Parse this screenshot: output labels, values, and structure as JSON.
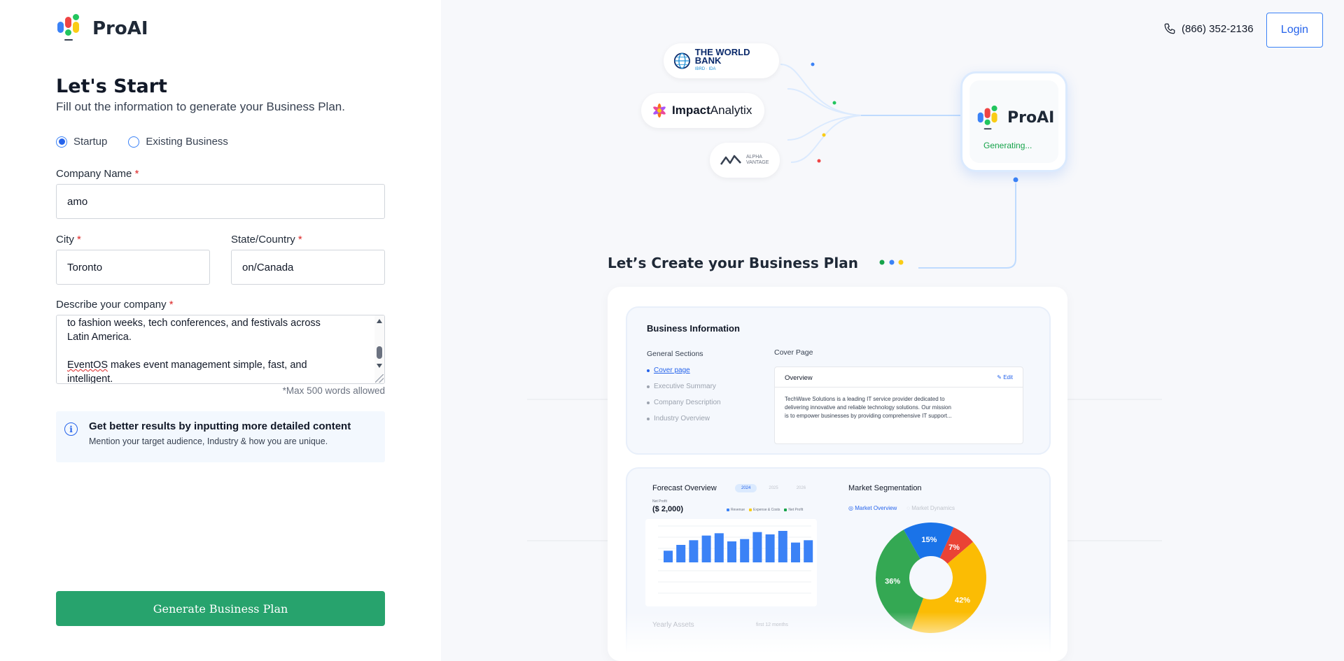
{
  "brand": {
    "name": "ProAI"
  },
  "form": {
    "title": "Let's Start",
    "subtitle": "Fill out the information to generate your Business Plan.",
    "business_type": {
      "options": [
        {
          "label": "Startup",
          "selected": true
        },
        {
          "label": "Existing Business",
          "selected": false
        }
      ]
    },
    "company_name": {
      "label": "Company Name",
      "value": "amo"
    },
    "city": {
      "label": "City",
      "value": "Toronto"
    },
    "state": {
      "label": "State/Country",
      "value": "on/Canada"
    },
    "describe": {
      "label": "Describe your company",
      "line1": "to fashion weeks, tech conferences, and festivals across",
      "line2": "Latin America.",
      "spell_word": "EventOS",
      "line3_rest": " makes event management simple, fast, and",
      "line4": "intelligent."
    },
    "required_mark": "*",
    "max_words_hint": "*Max 500 words allowed",
    "tip": {
      "title": "Get better results by inputting more detailed content",
      "text": "Mention your target audience, Industry & how you are unique."
    },
    "submit_label": "Generate Business Plan"
  },
  "header": {
    "phone": "(866) 352-2136",
    "login_label": "Login"
  },
  "integrations": {
    "world_bank": {
      "name": "THE WORLD BANK",
      "sub": "IBRD · IDA"
    },
    "impact": {
      "bold": "Impact",
      "rest": "Analytix"
    },
    "alpha": {
      "line1": "ALPHA",
      "line2": "VANTAGE"
    }
  },
  "generator": {
    "name": "ProAI",
    "status": "Generating..."
  },
  "preview": {
    "heading": "Let’s Create your Business Plan",
    "business_info": {
      "title": "Business Information",
      "general_sections_label": "General Sections",
      "sections": [
        "Cover page",
        "Executive Summary",
        "Company Description",
        "Industry Overview"
      ],
      "active_section": 0,
      "cover_page_label": "Cover Page",
      "overview_label": "Overview",
      "edit_label": "Edit",
      "overview_text": "TechWave Solutions is a leading IT service provider dedicated to delivering innovative and reliable technology solutions. Our mission is to empower businesses by providing comprehensive IT support..."
    },
    "forecast": {
      "title": "Forecast Overview",
      "years": [
        "2024",
        "2025",
        "2026"
      ],
      "selected_year": "2024",
      "net_profit_label": "Net Profit",
      "net_profit_value": "($ 2,000)",
      "legend": [
        {
          "name": "Revenue",
          "color": "#3b82f6"
        },
        {
          "name": "Expense & Costs",
          "color": "#facc15"
        },
        {
          "name": "Net Profit",
          "color": "#16a34a"
        }
      ]
    },
    "segmentation": {
      "title": "Market Segmentation",
      "tabs": [
        "Market Overview",
        "Market Dynamics"
      ]
    },
    "yearly_assets": {
      "title": "Yearly Assets",
      "period": "first 12 months"
    }
  },
  "chart_data": [
    {
      "type": "bar",
      "title": "Forecast Overview",
      "categories": [
        "1",
        "2",
        "3",
        "4",
        "5",
        "6",
        "7",
        "8",
        "9",
        "10",
        "11",
        "12"
      ],
      "values": [
        10,
        15,
        19,
        23,
        25,
        18,
        20,
        26,
        24,
        27,
        17,
        19
      ],
      "color": "#3b82f6"
    },
    {
      "type": "pie",
      "title": "Market Segmentation",
      "labels": [
        "15%",
        "7%",
        "42%",
        "36%"
      ],
      "values": [
        15,
        7,
        42,
        36
      ],
      "colors": [
        "#1a73e8",
        "#ea4335",
        "#fbbc04",
        "#34a853"
      ]
    }
  ]
}
